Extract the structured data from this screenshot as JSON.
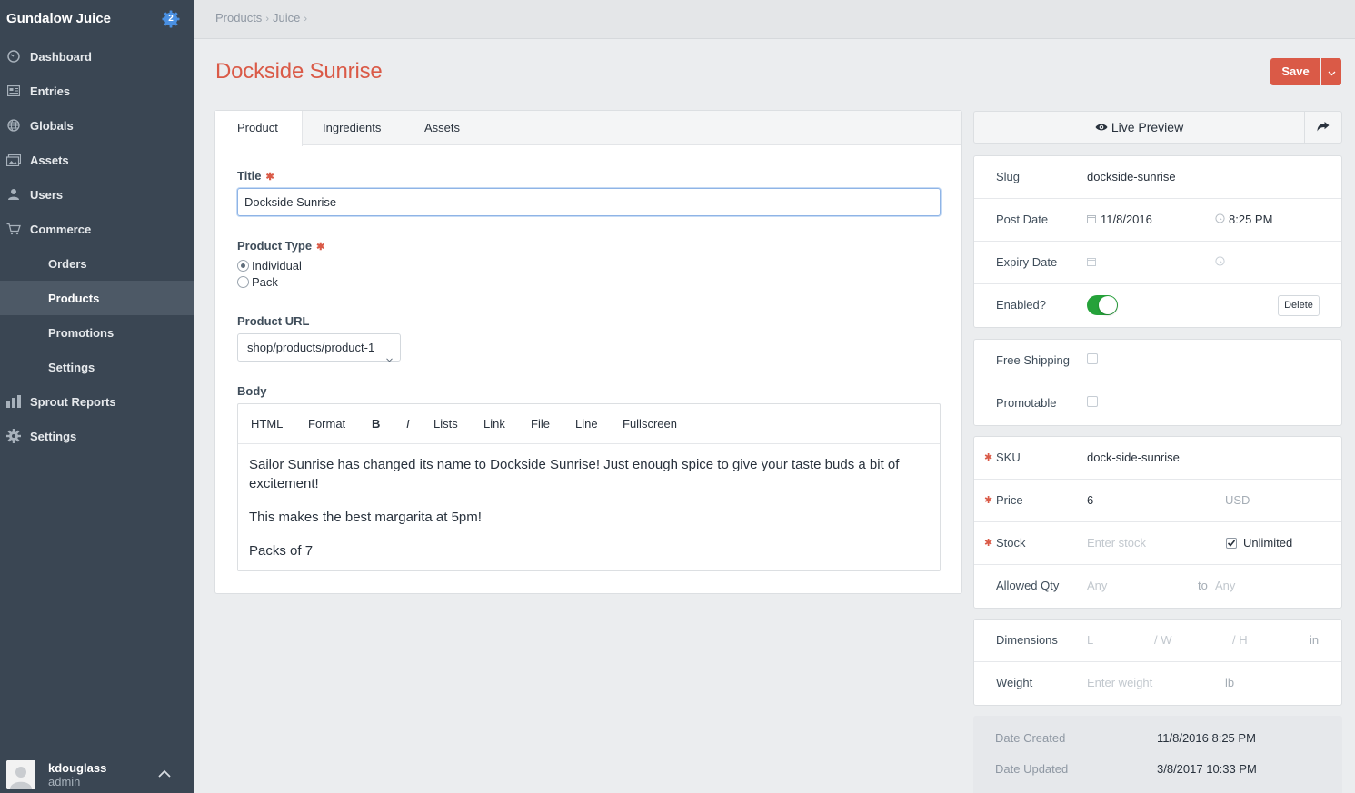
{
  "sidebar": {
    "site_name": "Gundalow Juice",
    "badge_count": "2",
    "items": [
      {
        "label": "Dashboard",
        "icon": "dashboard-icon"
      },
      {
        "label": "Entries",
        "icon": "entries-icon"
      },
      {
        "label": "Globals",
        "icon": "globe-icon"
      },
      {
        "label": "Assets",
        "icon": "assets-icon"
      },
      {
        "label": "Users",
        "icon": "users-icon"
      },
      {
        "label": "Commerce",
        "icon": "cart-icon"
      },
      {
        "label": "Orders"
      },
      {
        "label": "Products"
      },
      {
        "label": "Promotions"
      },
      {
        "label": "Settings"
      },
      {
        "label": "Sprout Reports",
        "icon": "bar-chart-icon"
      },
      {
        "label": "Settings",
        "icon": "gear-icon"
      }
    ],
    "user": {
      "name": "kdouglass",
      "role": "admin"
    }
  },
  "header": {
    "breadcrumb": [
      "Products",
      "Juice"
    ]
  },
  "page": {
    "title": "Dockside Sunrise",
    "save_label": "Save"
  },
  "tabs": [
    "Product",
    "Ingredients",
    "Assets"
  ],
  "form": {
    "title_label": "Title",
    "title_value": "Dockside Sunrise",
    "product_type_label": "Product Type",
    "product_type_options": [
      "Individual",
      "Pack"
    ],
    "product_type_selected": "Individual",
    "product_url_label": "Product URL",
    "product_url_value": "shop/products/product-1",
    "body_label": "Body",
    "toolbar": [
      "HTML",
      "Format",
      "B",
      "I",
      "Lists",
      "Link",
      "File",
      "Line",
      "Fullscreen"
    ],
    "body_paragraphs": [
      "Sailor Sunrise has changed its name to Dockside Sunrise!  Just enough spice to give your taste buds a bit of excitement!",
      "This makes the best margarita at 5pm!",
      "Packs of 7"
    ]
  },
  "right": {
    "live_preview_label": "Live Preview",
    "slug_label": "Slug",
    "slug_value": "dockside-sunrise",
    "post_date_label": "Post Date",
    "post_date_value": "11/8/2016",
    "post_time_value": "8:25 PM",
    "expiry_date_label": "Expiry Date",
    "enabled_label": "Enabled?",
    "enabled": true,
    "delete_label": "Delete",
    "free_shipping_label": "Free Shipping",
    "promotable_label": "Promotable",
    "sku_label": "SKU",
    "sku_value": "dock-side-sunrise",
    "price_label": "Price",
    "price_value": "6",
    "currency": "USD",
    "stock_label": "Stock",
    "stock_placeholder": "Enter stock",
    "unlimited_label": "Unlimited",
    "allowed_qty_label": "Allowed Qty",
    "allowed_min_placeholder": "Any",
    "allowed_to_label": "to",
    "allowed_max_placeholder": "Any",
    "dimensions_label": "Dimensions",
    "dim_l": "L",
    "dim_w": "/  W",
    "dim_h": "/  H",
    "dim_unit": "in",
    "weight_label": "Weight",
    "weight_placeholder": "Enter weight",
    "weight_unit": "lb",
    "date_created_label": "Date Created",
    "date_created_value": "11/8/2016 8:25 PM",
    "date_updated_label": "Date Updated",
    "date_updated_value": "3/8/2017 10:33 PM"
  },
  "colors": {
    "accent": "#da5a47",
    "sidebar_bg": "#3a4653",
    "toggle_on": "#25a23a",
    "badge": "#4a90e2"
  }
}
